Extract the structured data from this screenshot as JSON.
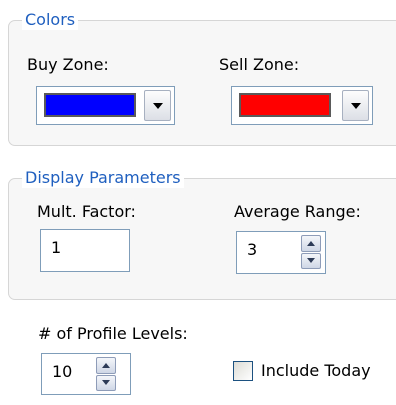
{
  "colors_group": {
    "legend": "Colors",
    "buy_zone_label": "Buy Zone:",
    "buy_zone_color": "#0000ff",
    "sell_zone_label": "Sell Zone:",
    "sell_zone_color": "#ff0000"
  },
  "display_group": {
    "legend": "Display Parameters",
    "mult_factor_label": "Mult. Factor:",
    "mult_factor_value": "1",
    "average_range_label": "Average Range:",
    "average_range_value": "3"
  },
  "profile": {
    "levels_label": "# of Profile Levels:",
    "levels_value": "10",
    "include_today_label": "Include Today",
    "include_today_checked": false
  },
  "theme": {
    "legend_color": "#1f5fbf"
  }
}
